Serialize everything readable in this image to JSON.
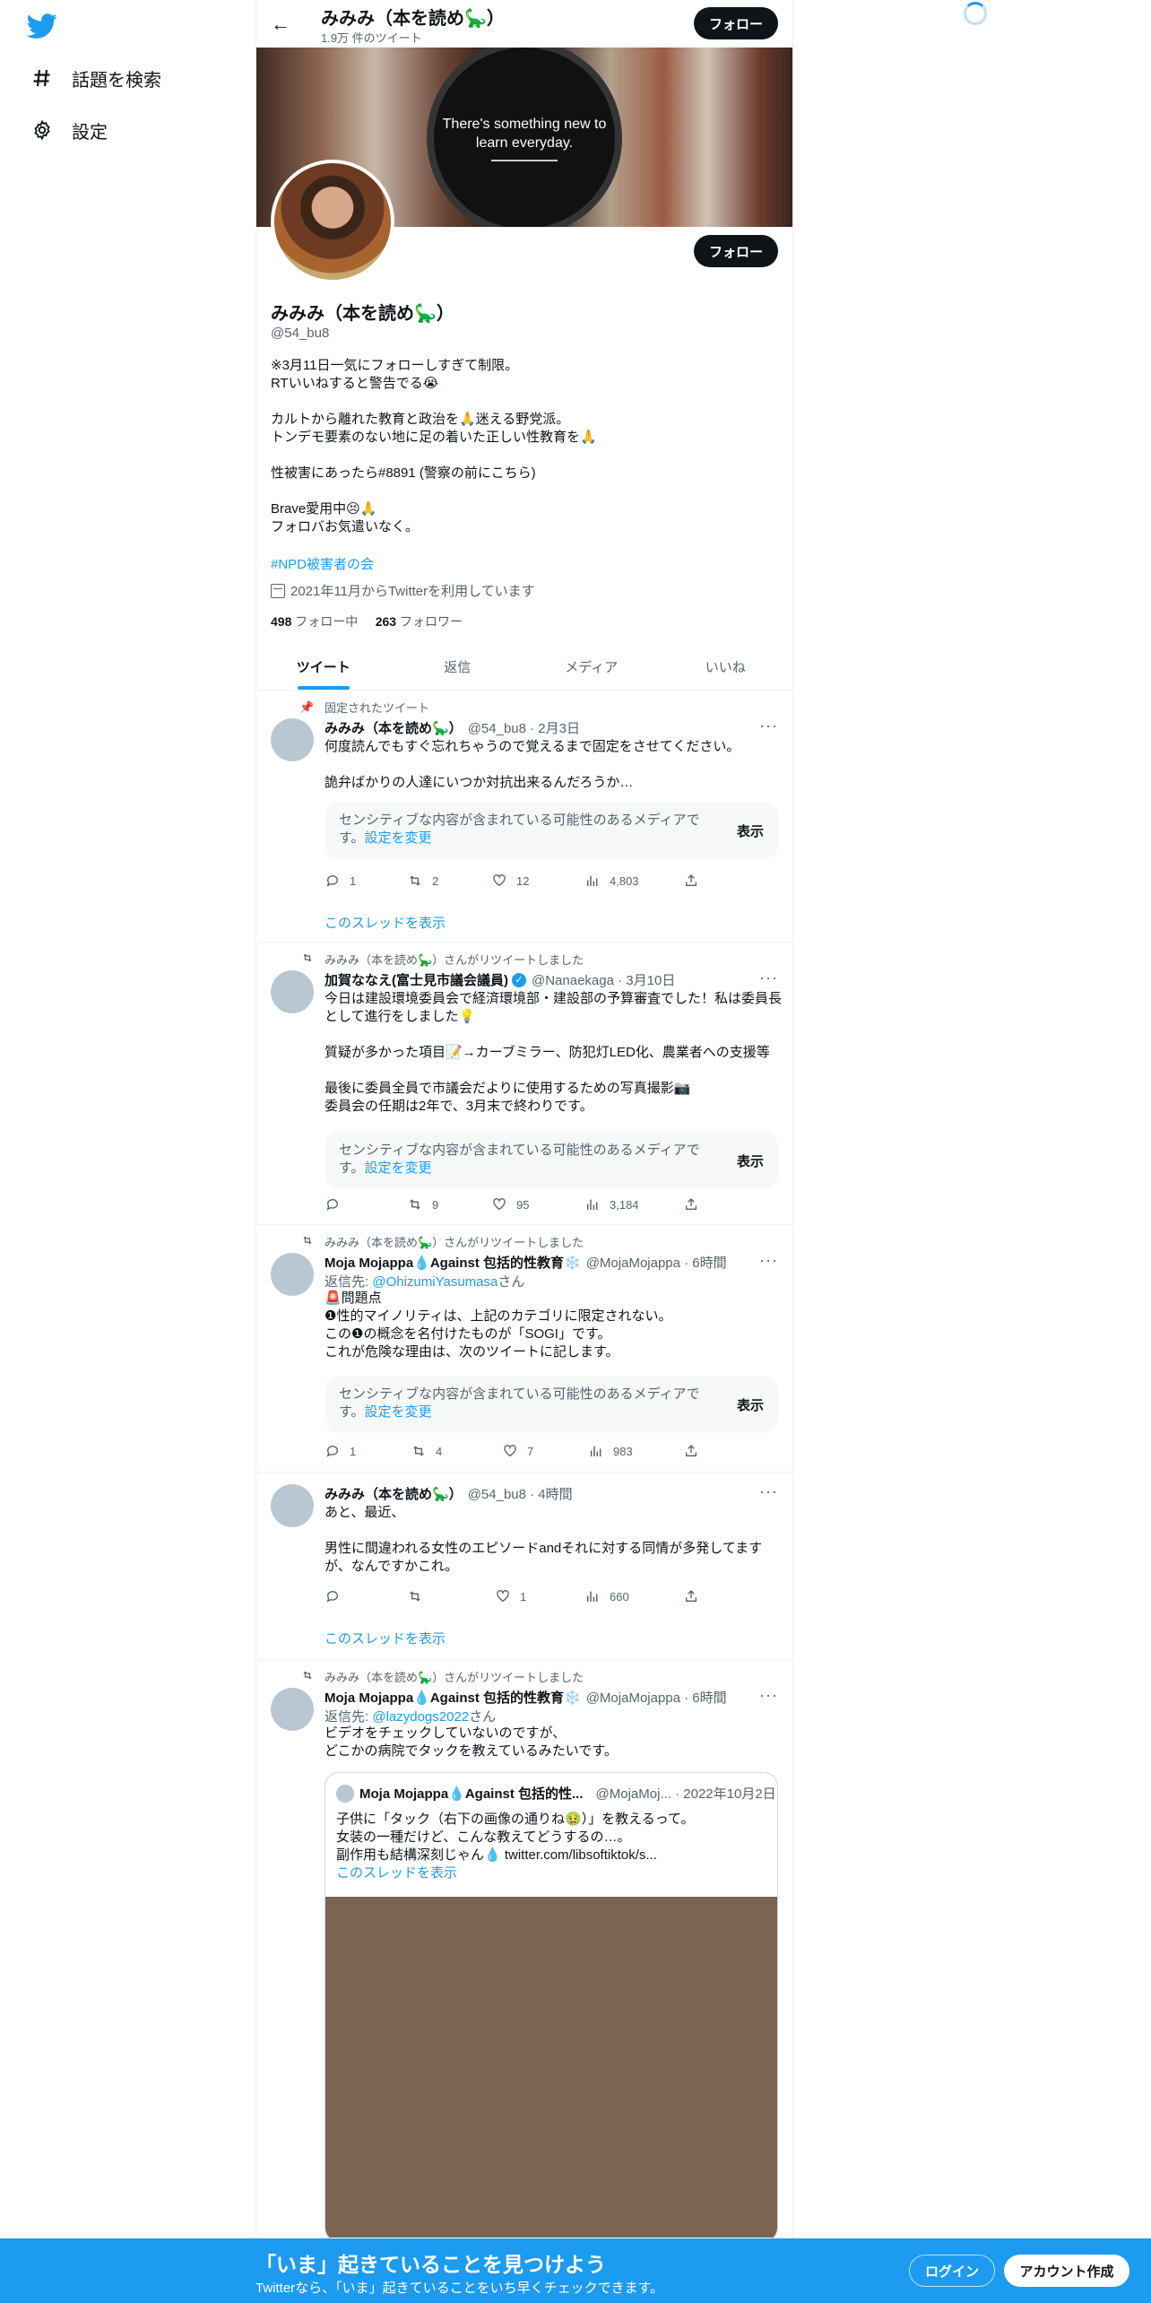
{
  "nav": {
    "explore_label": "話題を検索",
    "settings_label": "設定"
  },
  "topbar": {
    "name": "みみみ（本を読め🦕）",
    "tweet_count": "1.9万 件のツイート",
    "follow_label": "フォロー"
  },
  "banner": {
    "line1": "There's something new to",
    "line2": "learn everyday."
  },
  "profile": {
    "follow_label": "フォロー",
    "name": "みみみ（本を読め🦕）",
    "handle": "@54_bu8",
    "bio": [
      "※3月11日一気にフォローしすぎて制限。",
      "RTいいねすると警告でる😭",
      "",
      "カルトから離れた教育と政治を🙏迷える野党派。",
      "トンデモ要素のない地に足の着いた正しい性教育を🙏",
      "",
      "性被害にあったら#8891 (警察の前にこちら)",
      "",
      "Brave愛用中😣🙏",
      "フォロバお気遣いなく。"
    ],
    "hashtag": "#NPD被害者の会",
    "joined": "2021年11月からTwitterを利用しています",
    "following_count": "498",
    "following_label": "フォロー中",
    "followers_count": "263",
    "followers_label": "フォロワー"
  },
  "tabs": [
    "ツイート",
    "返信",
    "メディア",
    "いいね"
  ],
  "sensitive": {
    "text": "センシティブな内容が含まれている可能性のあるメディアです。",
    "settings_link": "設定を変更",
    "show_label": "表示"
  },
  "show_thread_label": "このスレッドを表示",
  "tweets": [
    {
      "context": "固定されたツイート",
      "name": "みみみ（本を読め🦕）",
      "meta": "@54_bu8 · 2月3日",
      "body": [
        "何度読んでもすぐ忘れちゃうので覚えるまで固定をさせてください。",
        "",
        "詭弁ばかりの人達にいつか対抗出来るんだろうか…"
      ],
      "reply": "",
      "retweet": "2",
      "like": "12",
      "views": "4,803",
      "replies": "1"
    },
    {
      "context": "みみみ（本を読め🦕）さんがリツイートしました",
      "name": "加賀ななえ(富士見市議会議員)",
      "meta": "@Nanaekaga · 3月10日",
      "body": [
        "今日は建設環境委員会で経済環境部・建設部の予算審査でした！私は委員長として進行をしました💡",
        "",
        "質疑が多かった項目📝→カーブミラー、防犯灯LED化、農業者への支援等",
        "",
        "最後に委員全員で市議会だよりに使用するための写真撮影📷",
        "委員会の任期は2年で、3月末で終わりです。"
      ],
      "replies": "",
      "retweet": "9",
      "like": "95",
      "views": "3,184"
    },
    {
      "context": "みみみ（本を読め🦕）さんがリツイートしました",
      "name": "Moja Mojappa💧Against 包括的性教育❄️",
      "meta": "@MojaMojappa · 6時間",
      "reply_prefix": "返信先: ",
      "reply_to": "@OhizumiYasumasa",
      "reply_suffix": "さん",
      "body": [
        "🚨問題点",
        "❶性的マイノリティは、上記のカテゴリに限定されない。",
        "この❶の概念を名付けたものが「SOGI」です。",
        "これが危険な理由は、次のツイートに記します。"
      ],
      "replies": "1",
      "retweet": "4",
      "like": "7",
      "views": "983"
    },
    {
      "context": "",
      "name": "みみみ（本を読め🦕）",
      "meta": "@54_bu8 · 4時間",
      "body": [
        "あと、最近、",
        "",
        "男性に間違われる女性のエピソードandそれに対する同情が多発してますが、なんですかこれ。"
      ],
      "replies": "",
      "retweet": "",
      "like": "1",
      "views": "660"
    },
    {
      "context": "みみみ（本を読め🦕）さんがリツイートしました",
      "name": "Moja Mojappa💧Against 包括的性教育❄️",
      "meta": "@MojaMojappa · 6時間",
      "reply_prefix": "返信先: ",
      "reply_to": "@lazydogs2022",
      "reply_suffix": "さん",
      "body": [
        "ビデオをチェックしていないのですが、",
        "どこかの病院でタックを教えているみたいです。"
      ],
      "quote": {
        "name": "Moja Mojappa💧Against 包括的性...",
        "meta": "@MojaMoj... · 2022年10月2日",
        "body": [
          "子供に「タック（右下の画像の通りね🤢）」を教えるって。",
          "女装の一種だけど、こんな教えてどうするの…。",
          "副作用も結構深刻じゃん💧 twitter.com/libsoftiktok/s..."
        ],
        "thread_label": "このスレッドを表示"
      }
    }
  ],
  "bottombar": {
    "title": "「いま」起きていることを見つけよう",
    "subtitle": "Twitterなら、「いま」起きていることをいち早くチェックできます。",
    "login": "ログイン",
    "signup": "アカウント作成"
  }
}
